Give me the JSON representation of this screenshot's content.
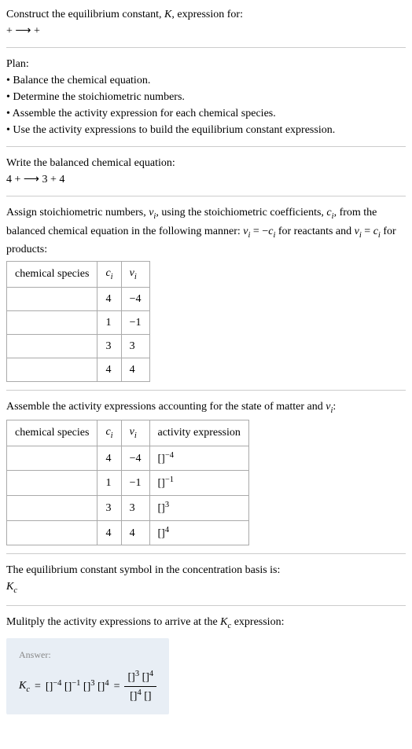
{
  "header": {
    "title_line1": "Construct the equilibrium constant, ",
    "title_k": "K",
    "title_line1_end": ", expression for:",
    "equation": " +  ⟶  + "
  },
  "plan": {
    "title": "Plan:",
    "items": [
      "• Balance the chemical equation.",
      "• Determine the stoichiometric numbers.",
      "• Assemble the activity expression for each chemical species.",
      "• Use the activity expressions to build the equilibrium constant expression."
    ]
  },
  "balanced": {
    "title": "Write the balanced chemical equation:",
    "equation": "4  +  ⟶ 3  + 4 "
  },
  "stoich": {
    "title_part1": "Assign stoichiometric numbers, ",
    "nu_i": "ν",
    "title_part2": ", using the stoichiometric coefficients, ",
    "c_i": "c",
    "title_part3": ", from the balanced chemical equation in the following manner: ",
    "formula1": "ν",
    "formula1_mid": " = −",
    "formula1_end": "c",
    "title_part4": " for reactants and ",
    "formula2": "ν",
    "formula2_mid": " = ",
    "formula2_end": "c",
    "title_part5": " for products:",
    "table": {
      "headers": [
        "chemical species",
        "c",
        "ν"
      ],
      "rows": [
        [
          "",
          "4",
          "−4"
        ],
        [
          "",
          "1",
          "−1"
        ],
        [
          "",
          "3",
          "3"
        ],
        [
          "",
          "4",
          "4"
        ]
      ]
    }
  },
  "activity": {
    "title_part1": "Assemble the activity expressions accounting for the state of matter and ",
    "nu_i": "ν",
    "title_part2": ":",
    "table": {
      "headers": [
        "chemical species",
        "c",
        "ν",
        "activity expression"
      ],
      "rows": [
        {
          "species": "",
          "c": "4",
          "nu": "−4",
          "expr_base": "[]",
          "expr_exp": "−4"
        },
        {
          "species": "",
          "c": "1",
          "nu": "−1",
          "expr_base": "[]",
          "expr_exp": "−1"
        },
        {
          "species": "",
          "c": "3",
          "nu": "3",
          "expr_base": "[]",
          "expr_exp": "3"
        },
        {
          "species": "",
          "c": "4",
          "nu": "4",
          "expr_base": "[]",
          "expr_exp": "4"
        }
      ]
    }
  },
  "kc_symbol": {
    "title": "The equilibrium constant symbol in the concentration basis is:",
    "symbol": "K",
    "sub": "c"
  },
  "multiply": {
    "title_part1": "Mulitply the activity expressions to arrive at the ",
    "k": "K",
    "sub": "c",
    "title_part2": " expression:"
  },
  "answer": {
    "label": "Answer:",
    "k": "K",
    "sub": "c",
    "equals": " = ",
    "terms": [
      {
        "base": "[]",
        "exp": "−4"
      },
      {
        "base": "[]",
        "exp": "−1"
      },
      {
        "base": "[]",
        "exp": "3"
      },
      {
        "base": "[]",
        "exp": "4"
      }
    ],
    "equals2": " = ",
    "fraction": {
      "num": [
        {
          "base": "[]",
          "exp": "3"
        },
        {
          "base": "[]",
          "exp": "4"
        }
      ],
      "den": [
        {
          "base": "[]",
          "exp": "4"
        },
        {
          "base": "[]",
          "exp": ""
        }
      ]
    }
  }
}
